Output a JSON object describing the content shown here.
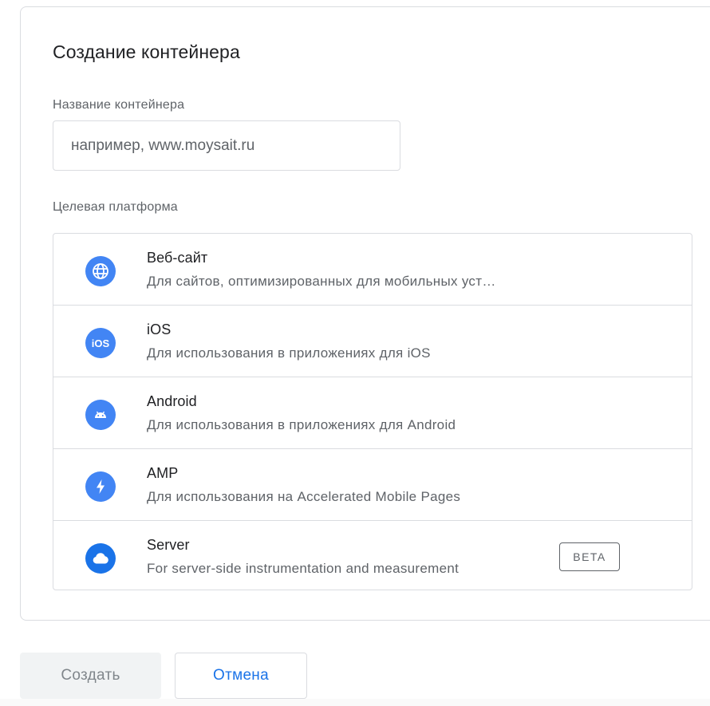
{
  "dialog": {
    "title": "Создание контейнера",
    "name_label": "Название контейнера",
    "name_placeholder": "например, www.moysait.ru",
    "name_value": "",
    "platform_label": "Целевая платформа"
  },
  "platforms": [
    {
      "name": "Веб-сайт",
      "description": "Для сайтов, оптимизированных для мобильных уст…",
      "icon": "globe-icon"
    },
    {
      "name": "iOS",
      "description": "Для использования в приложениях для iOS",
      "icon": "ios-icon"
    },
    {
      "name": "Android",
      "description": "Для использования в приложениях для Android",
      "icon": "android-icon"
    },
    {
      "name": "AMP",
      "description": "Для использования на Accelerated Mobile Pages",
      "icon": "lightning-icon"
    },
    {
      "name": "Server",
      "description": "For server-side instrumentation and measurement",
      "icon": "cloud-icon",
      "badge": "BETA"
    }
  ],
  "actions": {
    "create_label": "Создать",
    "cancel_label": "Отмена"
  },
  "colors": {
    "accent": "#1a73e8",
    "icon_blue": "#4285f4",
    "border": "#dadce0",
    "muted_text": "#5f6368"
  }
}
